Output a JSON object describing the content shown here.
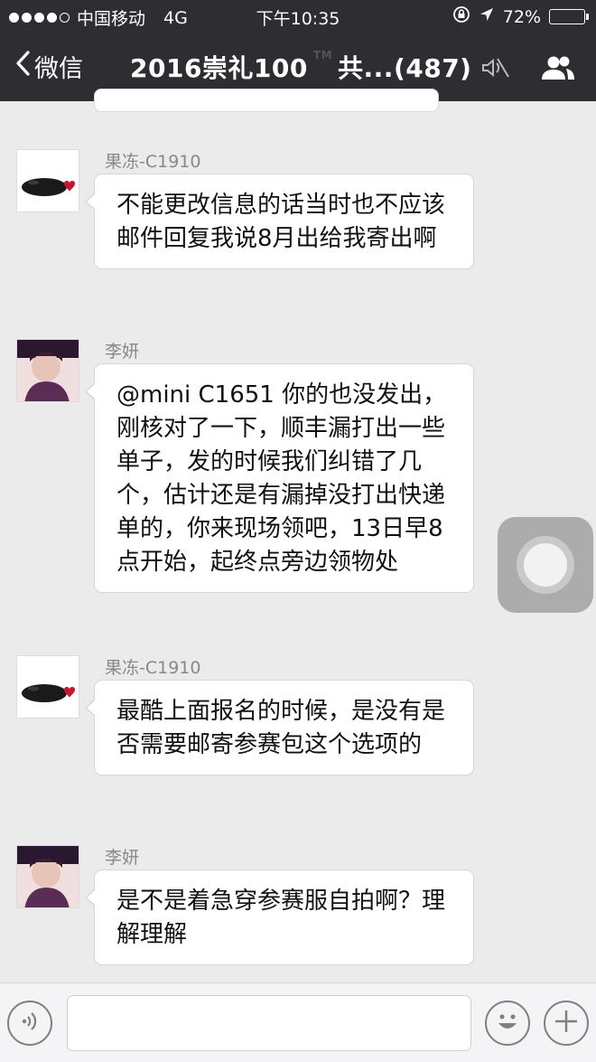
{
  "status_bar": {
    "carrier": "中国移动",
    "network": "4G",
    "time": "下午10:35",
    "battery": "72%",
    "battery_level": 0.72
  },
  "nav": {
    "back_label": "微信",
    "title": "2016崇礼100",
    "title_rest": "共...(487)",
    "icons": [
      "chevron-left-icon",
      "mute-icon",
      "group-members-icon"
    ]
  },
  "messages": [
    {
      "sender": "果冻-C1910",
      "avatar": "whale-avatar",
      "text": "不能更改信息的话当时也不应该邮件回复我说8月出给我寄出啊"
    },
    {
      "sender": "李妍",
      "avatar": "woman-avatar",
      "text": "@mini C1651 你的也没发出，刚核对了一下，顺丰漏打出一些单子，发的时候我们纠错了几个，估计还是有漏掉没打出快递单的，你来现场领吧，13日早8点开始，起终点旁边领物处"
    },
    {
      "sender": "果冻-C1910",
      "avatar": "whale-avatar",
      "text": "最酷上面报名的时候，是没有是否需要邮寄参赛包这个选项的"
    },
    {
      "sender": "李妍",
      "avatar": "woman-avatar",
      "text": "是不是着急穿参赛服自拍啊？理解理解"
    }
  ],
  "input_bar": {
    "value": "",
    "icons": [
      "voice-icon",
      "emoji-icon",
      "plus-icon"
    ]
  }
}
